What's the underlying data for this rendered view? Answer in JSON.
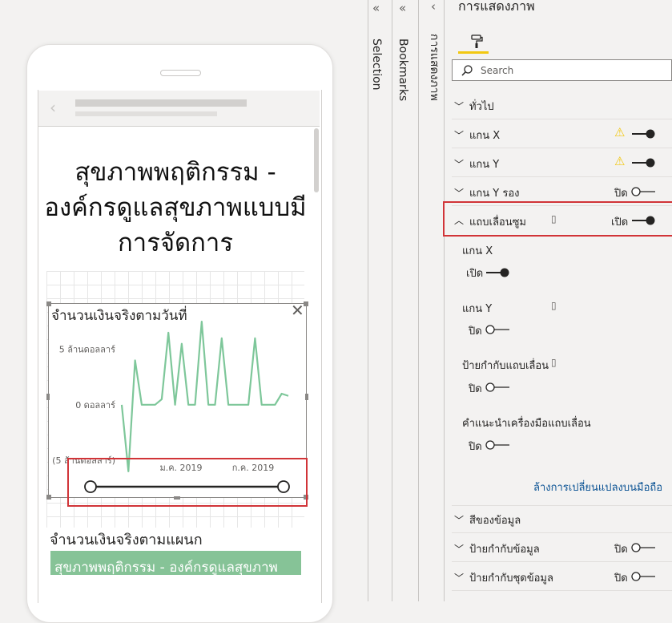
{
  "panes": {
    "filters_collapse": "«",
    "selection_collapse": "«",
    "bookmarks_collapse": "«",
    "format_collapse": "‹",
    "selection_label": "Selection",
    "bookmarks_label": "Bookmarks",
    "format_vertical_label": "การแสดงภาพ"
  },
  "phone": {
    "page_title": "สุขภาพพฤติกรรม - องค์กรดูแลสุขภาพแบบมีการจัดการ",
    "visual1": {
      "title": "จำนวนเงินจริงตามวันที่",
      "close": "✕"
    },
    "visual2": {
      "title": "จำนวนเงินจริงตามแผนก",
      "row_label": "สุขภาพพฤติกรรม - องค์กรดูแลสุขภาพ"
    }
  },
  "chart_data": {
    "type": "line",
    "title": "จำนวนเงินจริงตามวันที่",
    "ytick_labels": [
      "5 ล้านดอลลาร์",
      "0 ดอลลาร์",
      "(5 ล้านดอลลาร์)"
    ],
    "xtick_labels": [
      "ม.ค. 2019",
      "ก.ค. 2019"
    ],
    "ylim": [
      -5,
      7
    ],
    "series": [
      {
        "color": "#7ec79a",
        "values": [
          0,
          -6,
          4,
          0,
          0,
          0,
          0.5,
          6.5,
          0,
          5.5,
          0,
          0,
          7.5,
          0,
          0,
          6,
          0,
          0,
          0,
          0,
          6,
          0,
          0,
          0,
          1,
          0.8
        ]
      }
    ],
    "zoom_slider": true
  },
  "format": {
    "title": "การแสดงภาพ",
    "search_placeholder": "Search",
    "sections": [
      {
        "label": "ทั่วไป",
        "expanded": false
      },
      {
        "label": "แกน X",
        "expanded": false,
        "warning": true,
        "toggle": true
      },
      {
        "label": "แกน Y",
        "expanded": false,
        "warning": true,
        "toggle": true
      },
      {
        "label": "แกน Y รอง",
        "expanded": false,
        "toggle_text": "ปิด",
        "toggle": false
      },
      {
        "label": "แถบเลื่อนซูม",
        "expanded": true,
        "toggle_text": "เปิด",
        "toggle": true
      }
    ],
    "zoom": {
      "x_axis_label": "แกน X",
      "x_axis_toggle_text": "เปิด",
      "y_axis_label": "แกน Y",
      "y_axis_toggle_text": "ปิด",
      "slider_labels_label": "ป้ายกำกับแถบเลื่อน",
      "slider_labels_toggle_text": "ปิด",
      "slider_tooltips_label": "คำแนะนำเครื่องมือแถบเลื่อน",
      "slider_tooltips_toggle_text": "ปิด",
      "reset_link": "ล้างการเปลี่ยนแปลงบนมือถือ"
    },
    "more_sections": [
      {
        "label": "สีของข้อมูล"
      },
      {
        "label": "ป้ายกำกับข้อมูล",
        "toggle_text": "ปิด"
      },
      {
        "label": "ป้ายกำกับชุดข้อมูล",
        "toggle_text": "ปิด"
      }
    ]
  }
}
